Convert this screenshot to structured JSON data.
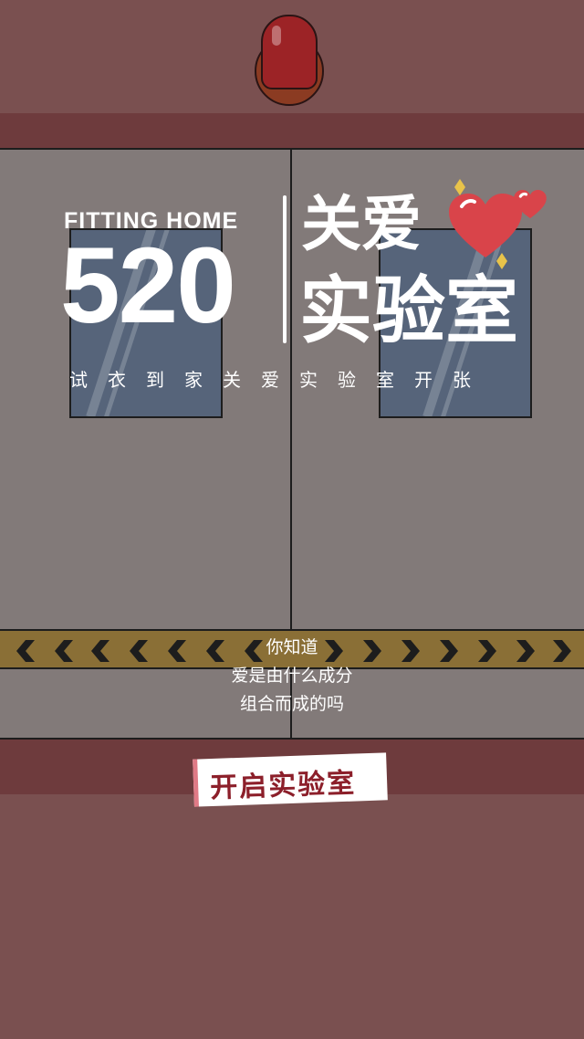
{
  "brand": {
    "english": "FITTING HOME",
    "number": "520",
    "title_line1": "关爱",
    "title_line2": "实验室"
  },
  "subtitle": "试衣到家关爱实验室开张",
  "question": {
    "line1": "你知道",
    "line2": "爱是由什么成分",
    "line3": "组合而成的吗"
  },
  "cta": {
    "label": "开启实验室"
  },
  "icons": {
    "alarm": "alarm-light-icon",
    "heart": "heart-icon",
    "sparkle": "sparkle-icon",
    "chevron_left": "chevron-left-icon",
    "chevron_right": "chevron-right-icon"
  },
  "colors": {
    "wall": "#7a5050",
    "strip": "#6e3b3d",
    "door": "#827a79",
    "window": "#56647a",
    "hazard": "#8a6f36",
    "alarm": "#9c2326",
    "heart": "#d9444a",
    "sparkle": "#e8c34a",
    "cta_text": "#8c1f2a"
  }
}
